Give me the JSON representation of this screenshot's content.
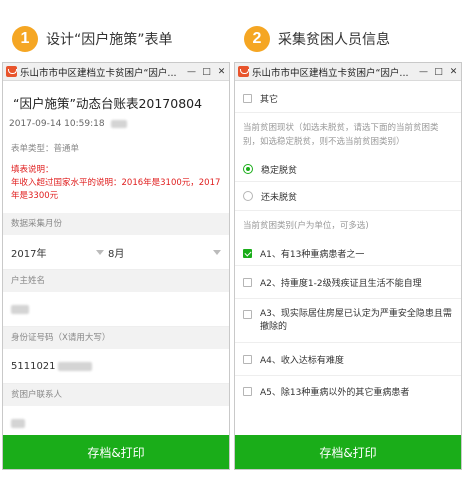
{
  "steps": [
    {
      "number": "1",
      "title": "设计“因户施策”表单"
    },
    {
      "number": "2",
      "title": "采集贫困人员信息"
    }
  ],
  "window": {
    "title": "乐山市市中区建档立卡贫困户“因户...",
    "min_glyph": "—",
    "max_glyph": "□",
    "close_glyph": "✕"
  },
  "left_form": {
    "title": "“因户施策”动态台账表20170804",
    "timestamp": "2017-09-14 10:59:18",
    "form_type": "表单类型：普通单",
    "notice_title": "填表说明：",
    "notice_body": "年收入超过国家水平的说明：2016年是3100元，2017年是3300元",
    "fields": {
      "month_label": "数据采集月份",
      "year_value": "2017年",
      "month_value": "8月",
      "head_name_label": "户主姓名",
      "id_label": "身份证号码（X请用大写）",
      "id_value": "5111021",
      "contact_label": "贫困户联系人"
    },
    "submit_label": "存档&打印"
  },
  "right_form": {
    "other_option": "其它",
    "status_hint": "当前贫困现状（如选未脱贫，请选下面的当前贫困类别，如选稳定脱贫，则不选当前贫困类别）",
    "status_options": [
      {
        "label": "稳定脱贫",
        "checked": true
      },
      {
        "label": "还未脱贫",
        "checked": false
      }
    ],
    "category_hint": "当前贫困类别(户为单位，可多选)",
    "category_options": [
      {
        "label": "A1、有13种重病患者之一",
        "checked": true
      },
      {
        "label": "A2、持重度1-2级残疾证且生活不能自理",
        "checked": false
      },
      {
        "label": "A3、现实际居住房屋已认定为严重安全隐患且需撤除的",
        "checked": false
      },
      {
        "label": "A4、收入达标有难度",
        "checked": false
      },
      {
        "label": "A5、除13种重病以外的其它重病患者",
        "checked": false
      }
    ],
    "submit_label": "存档&打印"
  }
}
